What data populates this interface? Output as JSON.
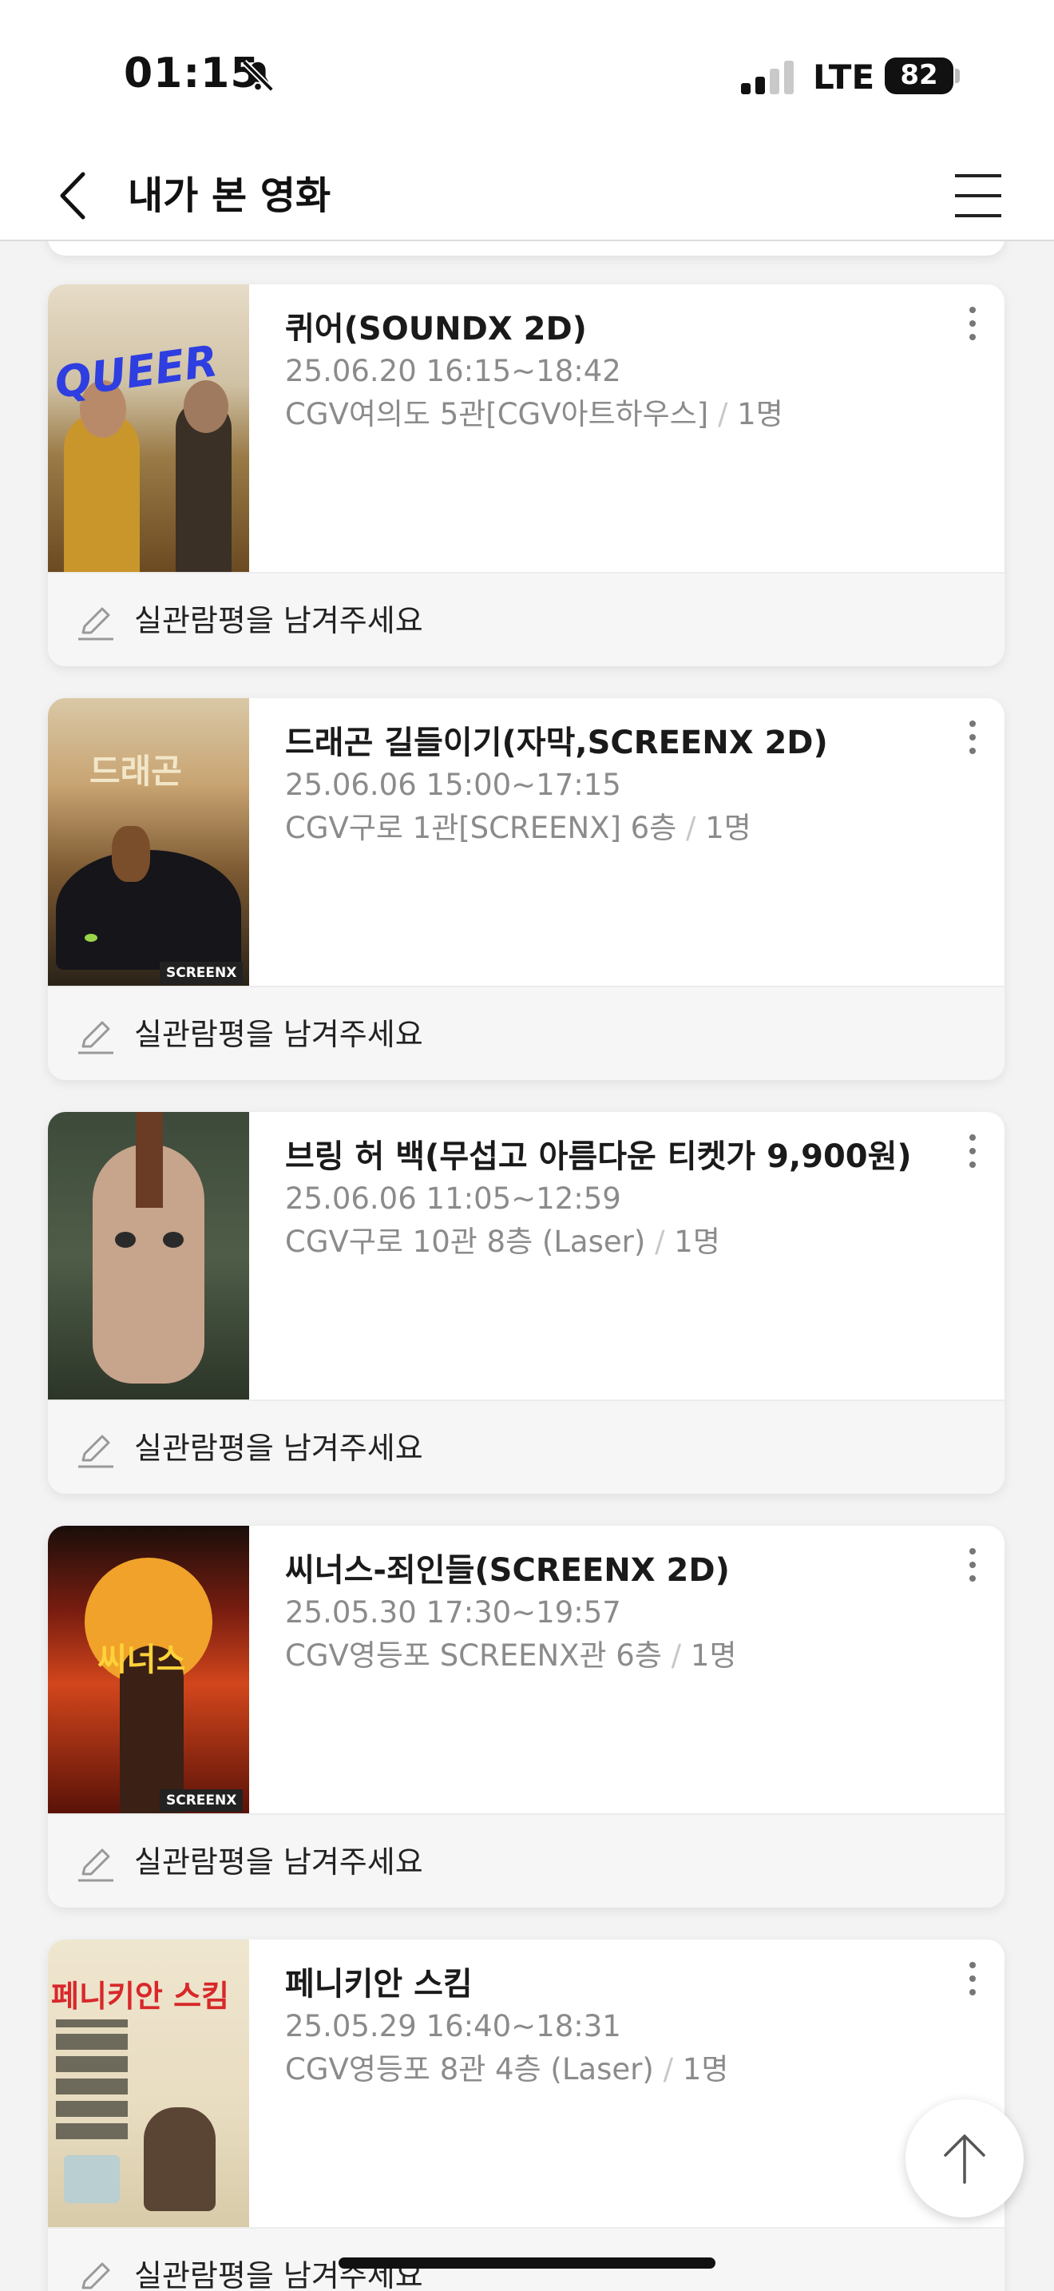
{
  "status": {
    "time": "01:15",
    "network": "LTE",
    "battery": "82"
  },
  "header": {
    "title": "내가 본 영화"
  },
  "movies": [
    {
      "title": "퀴어(SOUNDX 2D)",
      "datetime": "25.06.20 16:15~18:42",
      "theater": "CGV여의도 5관[CGV아트하우스]",
      "separator": "/",
      "count": "1명",
      "review_prompt": "실관람평을 남겨주세요",
      "poster_text": "QUEER"
    },
    {
      "title": "드래곤 길들이기(자막,SCREENX 2D)",
      "datetime": "25.06.06 15:00~17:15",
      "theater": "CGV구로 1관[SCREENX] 6층",
      "separator": "/",
      "count": "1명",
      "review_prompt": "실관람평을 남겨주세요",
      "poster_text": "드래곤",
      "poster_badge": "SCREENX"
    },
    {
      "title": "브링 허 백(무섭고 아름다운 티켓가 9,900원)",
      "datetime": "25.06.06 11:05~12:59",
      "theater": "CGV구로 10관 8층 (Laser)",
      "separator": "/",
      "count": "1명",
      "review_prompt": "실관람평을 남겨주세요"
    },
    {
      "title": "씨너스-죄인들(SCREENX 2D)",
      "datetime": "25.05.30 17:30~19:57",
      "theater": "CGV영등포 SCREENX관 6층",
      "separator": "/",
      "count": "1명",
      "review_prompt": "실관람평을 남겨주세요",
      "poster_text": "씨너스",
      "poster_badge": "SCREENX"
    },
    {
      "title": "페니키안 스킴",
      "datetime": "25.05.29 16:40~18:31",
      "theater": "CGV영등포 8관 4층 (Laser)",
      "separator": "/",
      "count": "1명",
      "review_prompt": "실관람평을 남겨주세요",
      "poster_text": "페니키안 스킴"
    }
  ],
  "icons": {
    "back": "chevron-left-icon",
    "menu": "hamburger-menu-icon",
    "more": "vertical-dots-icon",
    "pen": "pencil-icon",
    "scroll_top": "arrow-up-icon",
    "mute": "bell-slash-icon"
  },
  "colors": {
    "accent_text": "#1a1a1a",
    "muted_text": "#8b8b8b",
    "review_bg": "#f6f6f6"
  }
}
